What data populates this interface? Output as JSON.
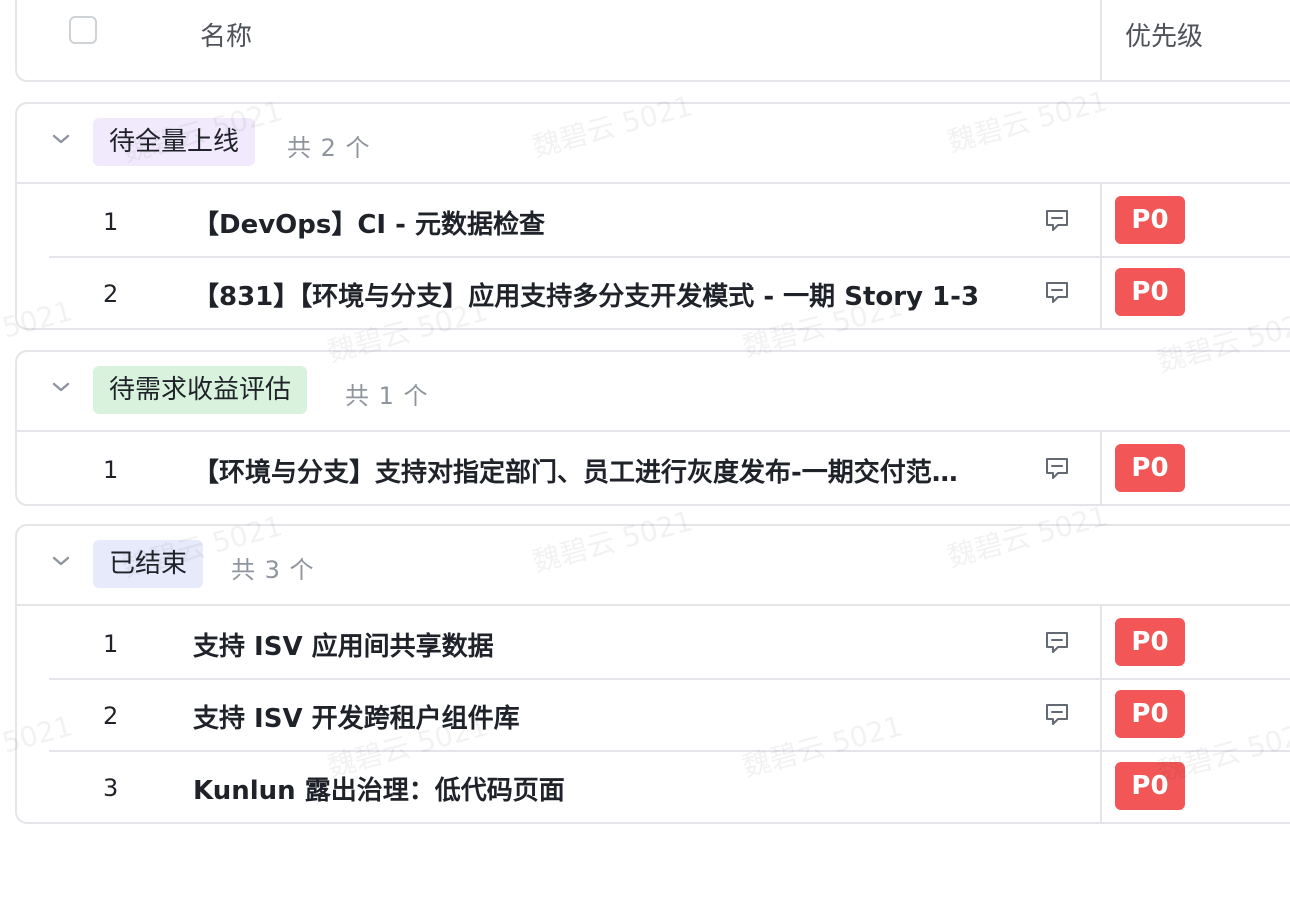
{
  "header": {
    "name_column": "名称",
    "priority_column": "优先级"
  },
  "groups": [
    {
      "tag": "待全量上线",
      "tag_color": "#f1e9fc",
      "count": "共 2 个",
      "rows": [
        {
          "index": "1",
          "title": "【DevOps】CI - 元数据检查",
          "has_comment": true,
          "priority": "P0"
        },
        {
          "index": "2",
          "title": "【831】【环境与分支】应用支持多分支开发模式 - 一期 Story 1-3",
          "has_comment": true,
          "priority": "P0"
        }
      ]
    },
    {
      "tag": "待需求收益评估",
      "tag_color": "#d9f2dd",
      "count": "共 1 个",
      "rows": [
        {
          "index": "1",
          "title": "【环境与分支】支持对指定部门、员工进行灰度发布-一期交付范…",
          "has_comment": true,
          "priority": "P0"
        }
      ]
    },
    {
      "tag": "已结束",
      "tag_color": "#e6eafb",
      "count": "共 3 个",
      "rows": [
        {
          "index": "1",
          "title": "支持 ISV 应用间共享数据",
          "has_comment": true,
          "priority": "P0"
        },
        {
          "index": "2",
          "title": "支持 ISV 开发跨租户组件库",
          "has_comment": true,
          "priority": "P0"
        },
        {
          "index": "3",
          "title": "Kunlun 露出治理：低代码页面",
          "has_comment": false,
          "priority": "P0"
        }
      ]
    }
  ],
  "watermark": "魏碧云 5021",
  "colors": {
    "priority_badge": "#f25656",
    "border": "#e3e5e8",
    "muted_text": "#8f959e"
  },
  "icons": {
    "collapse": "chevron-down-icon",
    "comment": "comment-icon",
    "select_all": "checkbox-icon"
  }
}
